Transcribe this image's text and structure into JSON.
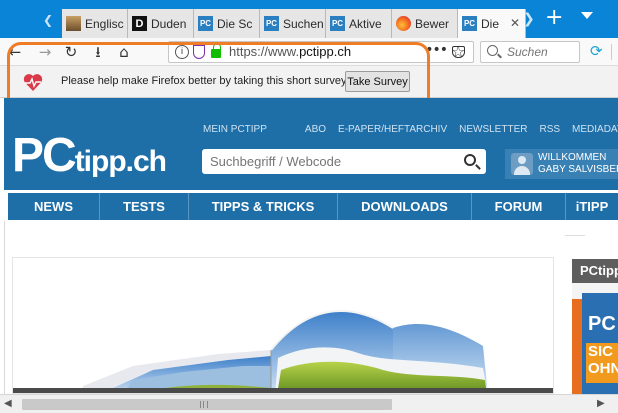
{
  "browser": {
    "tabs": [
      {
        "label": "Englisc",
        "icon": "english-site-favicon"
      },
      {
        "label": "Duden",
        "icon": "duden-favicon"
      },
      {
        "label": "Die Sc",
        "icon": "pctipp-favicon"
      },
      {
        "label": "Suchen",
        "icon": "pctipp-favicon"
      },
      {
        "label": "Aktive",
        "icon": "pctipp-favicon"
      },
      {
        "label": "Bewer",
        "icon": "firefox-favicon"
      },
      {
        "label": "Die",
        "icon": "pctipp-favicon",
        "active": true
      }
    ],
    "url_scheme": "https://www.",
    "url_host": "pctipp.ch",
    "search_placeholder": "Suchen",
    "accent_color": "#0a84d6"
  },
  "notification": {
    "message": "Please help make Firefox better by taking this short survey",
    "button_label": "Take Survey",
    "highlight_color": "#ef7c26"
  },
  "site": {
    "logo_pc": "PC",
    "logo_rest": "tipp.ch",
    "top_links": [
      "MEIN PCTIPP",
      "ABO",
      "E-PAPER/HEFTARCHIV",
      "NEWSLETTER",
      "RSS",
      "MEDIADATEN"
    ],
    "search_placeholder": "Suchbegriff / Webcode",
    "welcome_line1": "WILLKOMMEN",
    "welcome_line2": "GABY SALVISBERG",
    "nav": [
      "NEWS",
      "TESTS",
      "TIPPS & TRICKS",
      "DOWNLOADS",
      "FORUM",
      "iTIPP"
    ],
    "sidebox_title": "PCtipp",
    "magazine_title": "PC",
    "magazine_highlight": "SIC OHN",
    "brand_color": "#1e6ea8"
  }
}
